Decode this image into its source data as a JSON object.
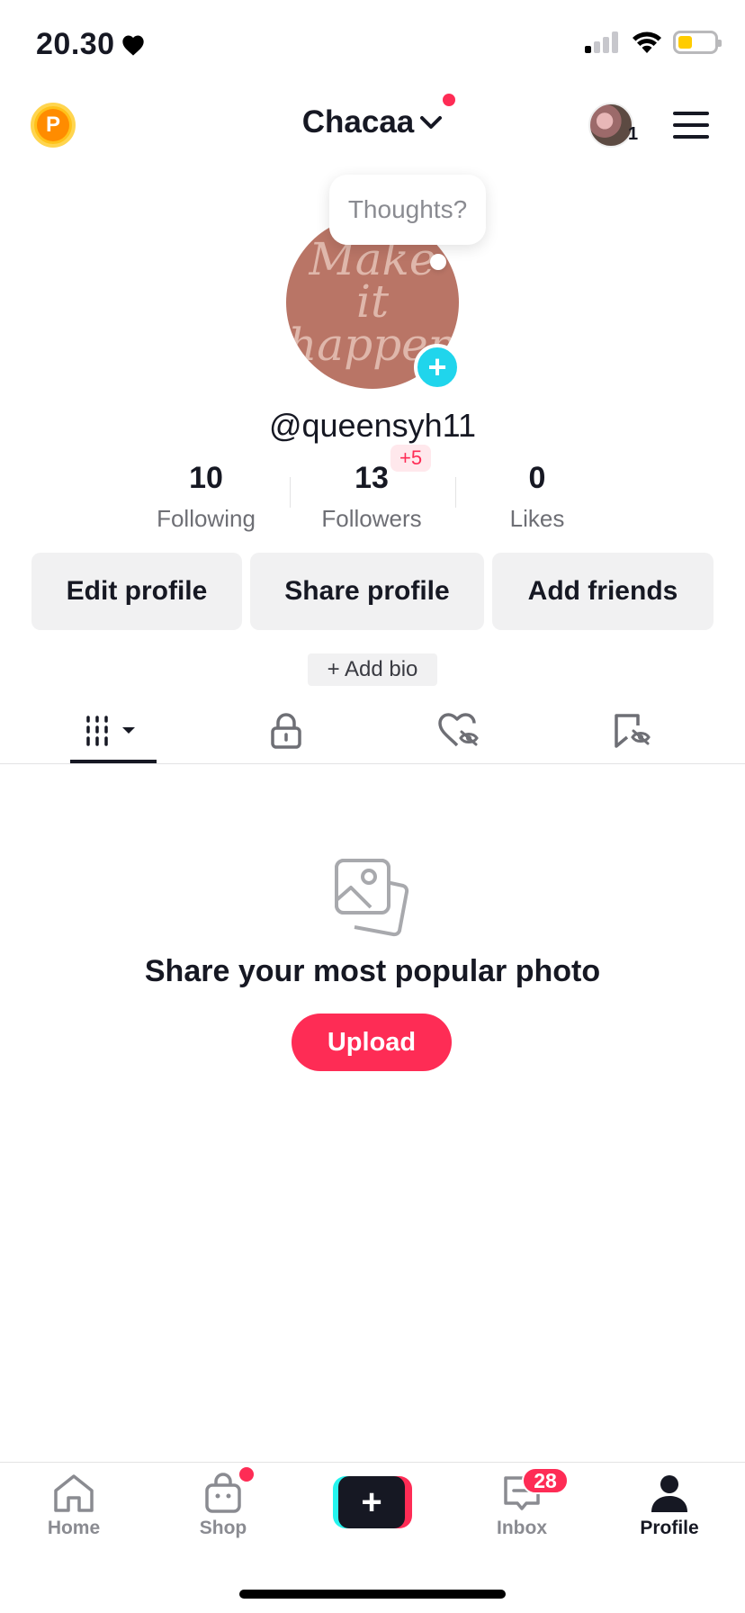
{
  "status_bar": {
    "time": "20.30"
  },
  "header": {
    "account_name": "Chacaa",
    "coin_letter": "P",
    "notification_count": "1"
  },
  "profile": {
    "bubble_text": "Thoughts?",
    "avatar_text": "Make it happen",
    "username": "@queensyh11",
    "followers_delta": "+5",
    "stats": [
      {
        "value": "10",
        "label": "Following"
      },
      {
        "value": "13",
        "label": "Followers"
      },
      {
        "value": "0",
        "label": "Likes"
      }
    ],
    "buttons": {
      "edit": "Edit profile",
      "share": "Share profile",
      "add_friends": "Add friends"
    },
    "bio": "+ Add bio"
  },
  "empty_state": {
    "message": "Share your most popular photo",
    "upload_label": "Upload"
  },
  "bottom_nav": {
    "items": [
      {
        "label": "Home"
      },
      {
        "label": "Shop"
      },
      {
        "label": "Inbox"
      },
      {
        "label": "Profile"
      }
    ],
    "inbox_badge": "28"
  },
  "colors": {
    "accent": "#fe2c55",
    "cyan": "#25f4ee",
    "text": "#161823"
  }
}
